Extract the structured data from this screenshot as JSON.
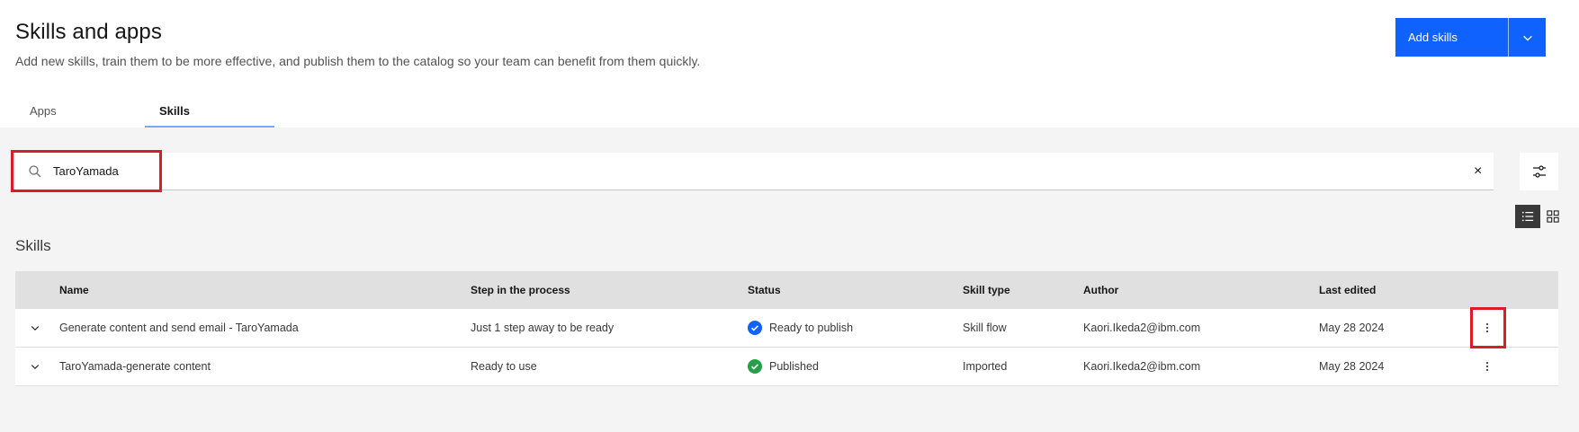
{
  "header": {
    "title": "Skills and apps",
    "subtitle": "Add new skills, train them to be more effective, and publish them to the catalog so your team can benefit from them quickly.",
    "add_button_label": "Add skills"
  },
  "tabs": [
    {
      "label": "Apps",
      "active": false
    },
    {
      "label": "Skills",
      "active": true
    }
  ],
  "search": {
    "value": "TaroYamada",
    "clear_label": "×"
  },
  "section": {
    "title": "Skills"
  },
  "table": {
    "columns": [
      "Name",
      "Step in the process",
      "Status",
      "Skill type",
      "Author",
      "Last edited"
    ],
    "rows": [
      {
        "name": "Generate content and send email - TaroYamada",
        "step": "Just 1 step away to be ready",
        "status": "Ready to publish",
        "status_color": "#0f62fe",
        "skill_type": "Skill flow",
        "author": "Kaori.Ikeda2@ibm.com",
        "last_edited": "May 28 2024"
      },
      {
        "name": "TaroYamada-generate content",
        "step": "Ready to use",
        "status": "Published",
        "status_color": "#24a148",
        "skill_type": "Imported",
        "author": "Kaori.Ikeda2@ibm.com",
        "last_edited": "May 28 2024"
      }
    ]
  },
  "colors": {
    "primary": "#0f62fe",
    "highlight": "#da1e28",
    "published": "#24a148"
  }
}
